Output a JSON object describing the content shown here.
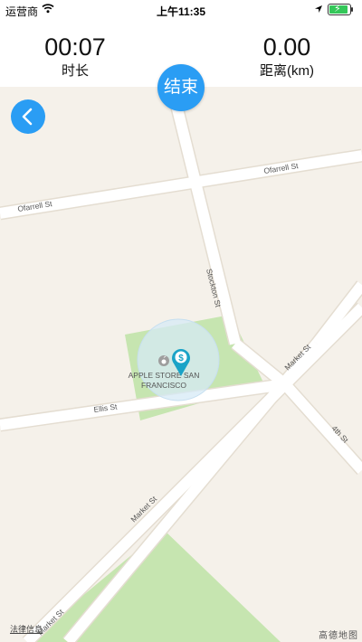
{
  "status_bar": {
    "carrier": "运营商",
    "time": "上午11:35",
    "icons": [
      "wifi-icon",
      "location-arrow-icon",
      "battery-charging-icon"
    ]
  },
  "stats": {
    "duration_value": "00:07",
    "duration_label": "时长",
    "distance_value": "0.00",
    "distance_label": "距离(km)"
  },
  "controls": {
    "end_label": "结束",
    "back_icon": "chevron-left-icon",
    "accent_color": "#2a9df4"
  },
  "map": {
    "streets": [
      "Ofarrell St",
      "Ofarrell St",
      "Stockton St",
      "Market St",
      "Ellis St",
      "4th St",
      "Market St",
      "Market St"
    ],
    "poi_name_line1": "APPLE STORE SAN",
    "poi_name_line2": "FRANCISCO",
    "marker_icon": "dollar-location-pin-icon",
    "legal_text": "法律信息",
    "logo_text": "高德地图"
  }
}
